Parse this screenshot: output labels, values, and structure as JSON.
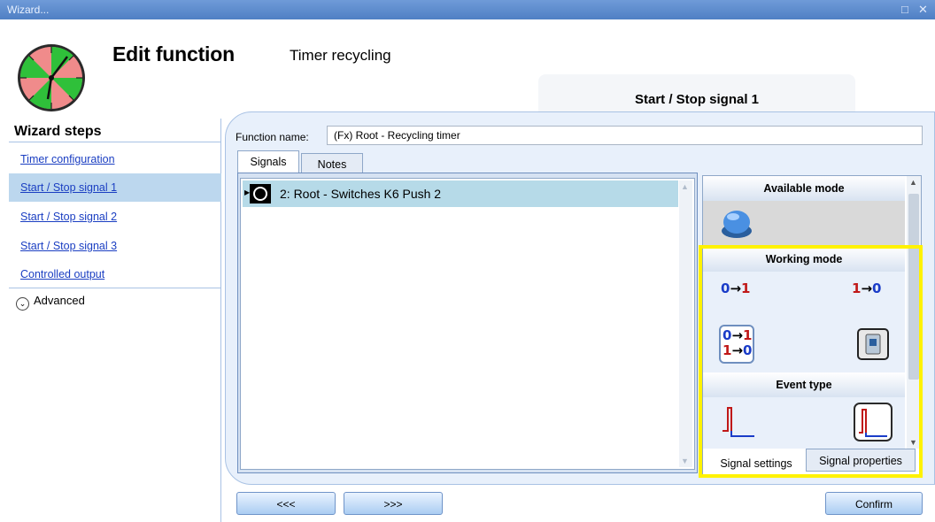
{
  "window": {
    "title": "Wizard...",
    "restore_icon": "restore-icon",
    "close_icon": "close-icon"
  },
  "header": {
    "title": "Edit function",
    "subtitle": "Timer recycling",
    "current_step_tab": "Start / Stop signal 1"
  },
  "sidebar": {
    "title": "Wizard steps",
    "items": [
      {
        "label": "Timer configuration",
        "active": false
      },
      {
        "label": "Start / Stop signal 1",
        "active": true
      },
      {
        "label": "Start / Stop signal 2",
        "active": false
      },
      {
        "label": "Start / Stop signal 3",
        "active": false
      },
      {
        "label": "Controlled output",
        "active": false
      }
    ],
    "advanced_label": "Advanced"
  },
  "form": {
    "function_name_label": "Function name:",
    "function_name_value": "(Fx) Root - Recycling timer"
  },
  "tabs": {
    "signals": "Signals",
    "notes": "Notes"
  },
  "signals_list": [
    {
      "text": "2: Root - Switches K6 Push 2",
      "selected": true
    }
  ],
  "right_panel": {
    "available_mode_title": "Available mode",
    "working_mode_title": "Working mode",
    "working_modes": [
      "0→1",
      "1→0",
      "0→1 / 1→0",
      "switch"
    ],
    "event_type_title": "Event type",
    "tab_settings": "Signal settings",
    "tab_properties": "Signal properties"
  },
  "footer": {
    "prev_label": "<<<",
    "next_label": ">>>",
    "confirm_label": "Confirm"
  },
  "colors": {
    "highlight": "#fff200",
    "selected_row": "#b6dae8",
    "active_step": "#bcd7ee"
  }
}
